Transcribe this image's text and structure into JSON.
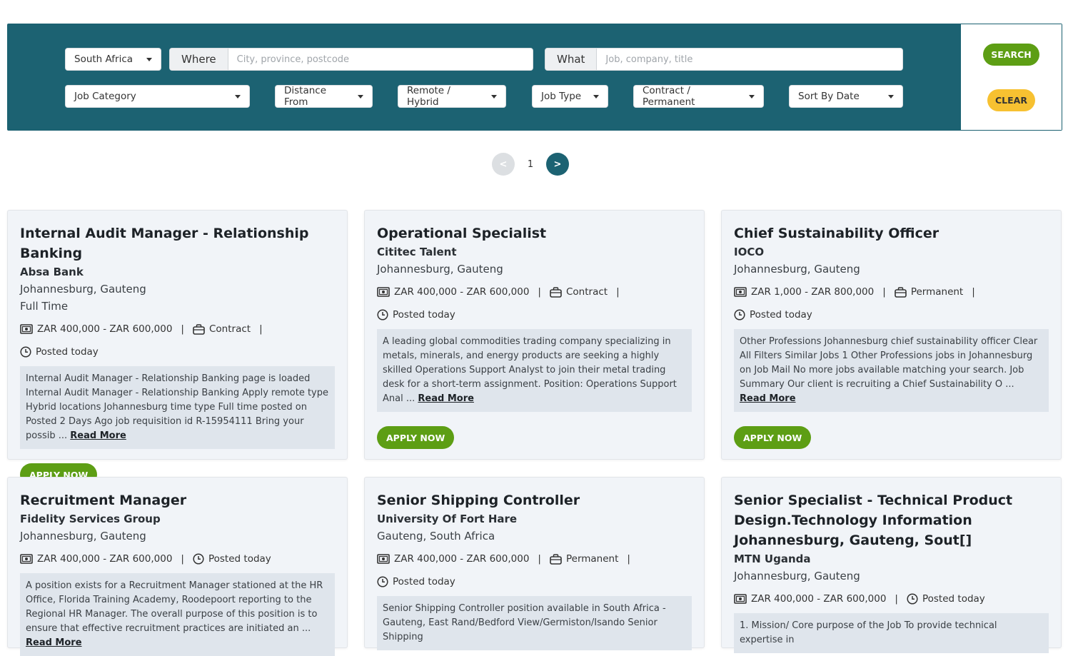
{
  "filters": {
    "country": "South Africa",
    "where_label": "Where",
    "where_placeholder": "City, province, postcode",
    "what_label": "What",
    "what_placeholder": "Job, company, title",
    "job_category": "Job Category",
    "distance_from": "Distance From",
    "remote_hybrid": "Remote / Hybrid",
    "job_type": "Job Type",
    "contract_permanent": "Contract / Permanent",
    "sort_by": "Sort By Date",
    "search_button": "SEARCH",
    "clear_button": "CLEAR"
  },
  "pagination": {
    "prev": "<",
    "current": "1",
    "next": ">"
  },
  "apply_label": "APPLY NOW",
  "read_more": "Read More",
  "colors": {
    "panel": "#1c6272",
    "search": "#5d9e14",
    "clear": "#f7c131"
  },
  "jobs": [
    {
      "title": "Internal Audit Manager - Relationship Banking",
      "company": "Absa Bank",
      "location": "Johannesburg, Gauteng",
      "employment": "Full Time",
      "salary": "ZAR 400,000 - ZAR 600,000",
      "contract": "Contract",
      "posted": "Posted today",
      "description": "Internal Audit Manager - Relationship Banking page is loaded Internal Audit Manager - Relationship Banking Apply remote type Hybrid locations Johannesburg time type Full time posted on Posted 2 Days Ago job requisition id R-15954111 Bring your possib ..."
    },
    {
      "title": "Operational Specialist",
      "company": "Cititec Talent",
      "location": "Johannesburg, Gauteng",
      "salary": "ZAR 400,000 - ZAR 600,000",
      "contract": "Contract",
      "posted": "Posted today",
      "description": "A leading global commodities trading company specializing in metals, minerals, and energy products are seeking a highly skilled Operations Support Analyst to join their metal trading desk for a short-term assignment. Position: Operations Support Anal ..."
    },
    {
      "title": "Chief Sustainability Officer",
      "company": "IOCO",
      "location": "Johannesburg, Gauteng",
      "salary": "ZAR 1,000 - ZAR 800,000",
      "contract": "Permanent",
      "posted": "Posted today",
      "description": "Other Professions Johannesburg chief sustainability officer Clear All Filters Similar Jobs 1 Other Professions jobs in Johannesburg on Job Mail No more jobs available matching your search. Job Summary Our client is recruiting a Chief Sustainability O ..."
    },
    {
      "title": "Recruitment Manager",
      "company": "Fidelity Services Group",
      "location": "Johannesburg, Gauteng",
      "salary": "ZAR 400,000 - ZAR 600,000",
      "posted": "Posted today",
      "description": "A position exists for a Recruitment Manager stationed at the HR Office, Florida Training Academy, Roodepoort reporting to the Regional HR Manager. The overall purpose of this position is to ensure that effective recruitment practices are initiated an ..."
    },
    {
      "title": "Senior Shipping Controller",
      "company": "University Of Fort Hare",
      "location": "Gauteng, South Africa",
      "salary": "ZAR 400,000 - ZAR 600,000",
      "contract": "Permanent",
      "posted": "Posted today",
      "description": "Senior Shipping Controller position available in South Africa - Gauteng, East Rand/Bedford View/Germiston/Isando Senior Shipping"
    },
    {
      "title": "Senior Specialist - Technical Product Design.Technology Information Johannesburg, Gauteng, Sout[]",
      "company": "MTN Uganda",
      "location": "Johannesburg, Gauteng",
      "salary": "ZAR 400,000 - ZAR 600,000",
      "posted": "Posted today",
      "description": "1. Mission/ Core purpose of the Job To provide technical expertise in"
    }
  ]
}
